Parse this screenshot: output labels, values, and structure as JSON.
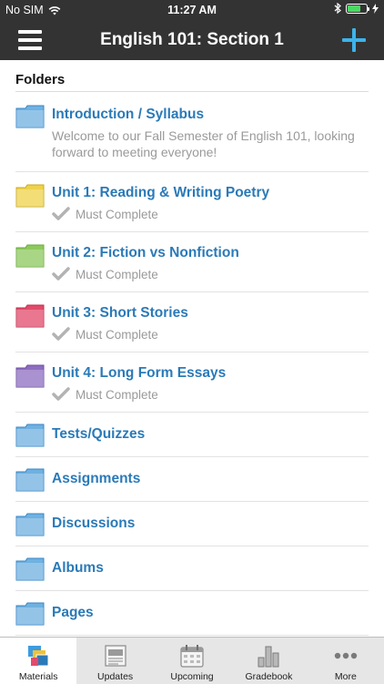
{
  "status_bar": {
    "carrier": "No SIM",
    "time": "11:27 AM",
    "battery_level": 0.7
  },
  "nav": {
    "title": "English 101: Section 1",
    "menu_icon": "hamburger-menu-icon",
    "add_icon": "plus-icon"
  },
  "section_title": "Folders",
  "folders": [
    {
      "title": "Introduction / Syllabus",
      "description": "Welcome to our Fall Semester of English 101, looking forward to meeting everyone!",
      "status": "",
      "color": "#6fb1e0"
    },
    {
      "title": "Unit 1: Reading & Writing Poetry",
      "description": "",
      "status": "Must Complete",
      "color": "#efd24a"
    },
    {
      "title": "Unit 2: Fiction vs Nonfiction",
      "description": "",
      "status": "Must Complete",
      "color": "#8dc95c"
    },
    {
      "title": "Unit 3: Short Stories",
      "description": "",
      "status": "Must Complete",
      "color": "#e24a6a"
    },
    {
      "title": "Unit 4: Long Form Essays",
      "description": "",
      "status": "Must Complete",
      "color": "#8e6cc1"
    },
    {
      "title": "Tests/Quizzes",
      "description": "",
      "status": "",
      "color": "#6fb1e0"
    },
    {
      "title": "Assignments",
      "description": "",
      "status": "",
      "color": "#6fb1e0"
    },
    {
      "title": "Discussions",
      "description": "",
      "status": "",
      "color": "#6fb1e0"
    },
    {
      "title": "Albums",
      "description": "",
      "status": "",
      "color": "#6fb1e0"
    },
    {
      "title": "Pages",
      "description": "",
      "status": "",
      "color": "#6fb1e0"
    }
  ],
  "tabs": [
    {
      "label": "Materials",
      "icon": "materials-icon",
      "active": true
    },
    {
      "label": "Updates",
      "icon": "updates-icon",
      "active": false
    },
    {
      "label": "Upcoming",
      "icon": "calendar-icon",
      "active": false
    },
    {
      "label": "Gradebook",
      "icon": "bar-chart-icon",
      "active": false
    },
    {
      "label": "More",
      "icon": "more-dots-icon",
      "active": false
    }
  ],
  "colors": {
    "bar_background": "#333333",
    "accent": "#3db3ea",
    "link": "#2a7ab8"
  }
}
